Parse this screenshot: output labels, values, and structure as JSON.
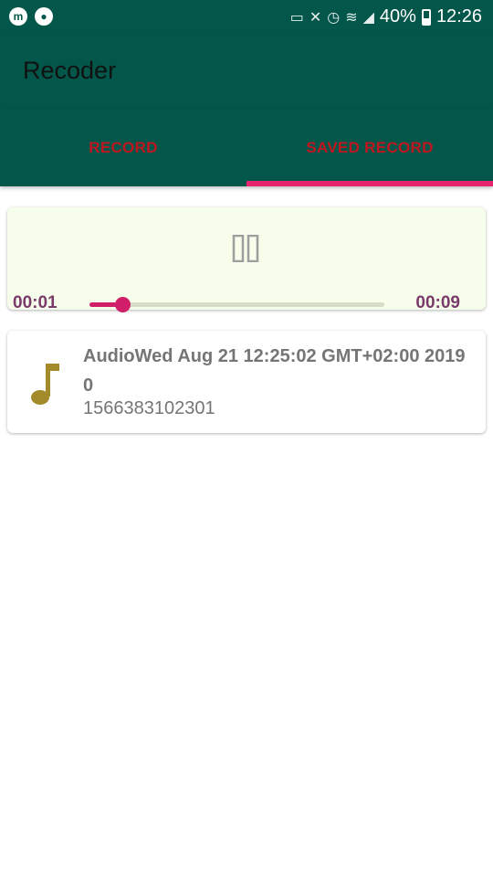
{
  "status_bar": {
    "battery": "40%",
    "time": "12:26",
    "left_icons": [
      "m-app-icon",
      "chat-notification-icon"
    ],
    "right_icons": [
      "cast-icon",
      "mute-icon",
      "alarm-icon",
      "wifi-icon",
      "signal-icon",
      "battery-icon"
    ]
  },
  "app_bar": {
    "title": "Recoder"
  },
  "tabs": [
    {
      "label": "RECORD",
      "selected": false
    },
    {
      "label": "SAVED RECORD",
      "selected": true
    }
  ],
  "player": {
    "icon": "pause-icon",
    "current_time": "00:01",
    "total_time": "00:09",
    "progress": 0.11
  },
  "recordings": [
    {
      "icon": "music-note-icon",
      "title": "AudioWed Aug 21 12:25:02 GMT+02:00 2019 0",
      "subtitle": "1566383102301"
    }
  ],
  "colors": {
    "primary": "#03574a",
    "tab_text": "#c0161f",
    "accent": "#e6256e",
    "player_bg": "#f6fdeb",
    "time_text": "#7a3a6a",
    "music_icon": "#a38b2c"
  }
}
